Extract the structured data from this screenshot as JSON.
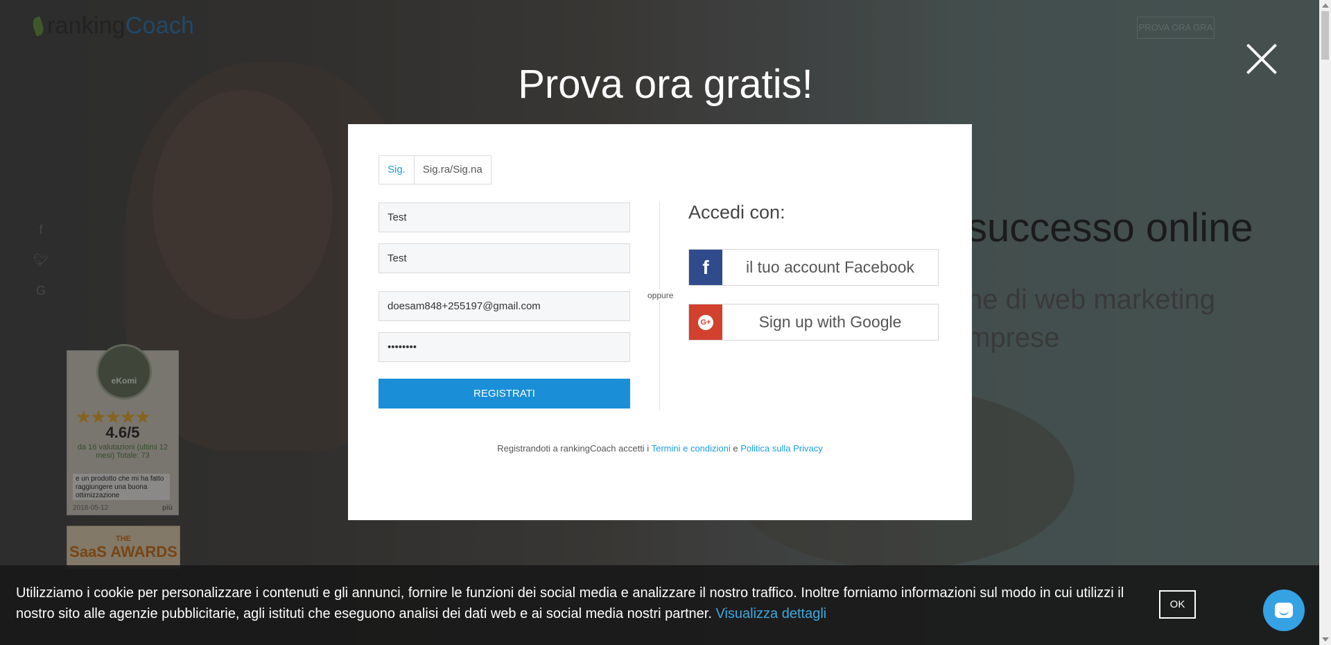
{
  "header": {
    "logo_part1": "ranking",
    "logo_part2": "Coach",
    "top_button": "PROVA ORA GRA"
  },
  "hero": {
    "headline_fragment": "successo online",
    "sub_line1": "ne di web marketing",
    "sub_line2": "mprese"
  },
  "ekomi": {
    "badge": "eKomi",
    "score": "4.6/5",
    "votes": "da 16 valutazioni (ultimi 12 mesi) Totale: 73",
    "review": "e un prodotto che mi ha fatto raggiungere una buona ottimizzazione",
    "date": "2018-05-12",
    "more": "più",
    "stars": "★★★★★"
  },
  "saas": {
    "line1": "THE",
    "line2": "SaaS AWARDS"
  },
  "modal": {
    "title": "Prova ora gratis!",
    "tabs": [
      "Sig.",
      "Sig.ra/Sig.na"
    ],
    "first_name_value": "Test",
    "last_name_value": "Test",
    "email_value": "doesam848+255197@gmail.com",
    "password_value": "••••••••",
    "register_label": "REGISTRATI",
    "oppure": "oppure",
    "login_with": "Accedi con:",
    "facebook_label": "il tuo account Facebook",
    "google_label": "Sign up with Google",
    "terms_prefix": "Registrandoti a rankingCoach accetti i",
    "terms_link": "Termini e condizioni",
    "terms_and": "e",
    "privacy_link": "Politica sulla Privacy"
  },
  "cookie": {
    "text": "Utilizziamo i cookie per personalizzare i contenuti e gli annunci, fornire le funzioni dei social media e analizzare il nostro traffico. Inoltre forniamo informazioni sul modo in cui utilizzi il nostro sito alle agenzie pubblicitarie, agli istituti che eseguono analisi dei dati web e ai social media nostri partner.",
    "link": "Visualizza dettagli",
    "ok": "OK"
  },
  "colors": {
    "accent": "#1a8fd8",
    "facebook": "#2f4b8c",
    "google": "#d1412e"
  }
}
